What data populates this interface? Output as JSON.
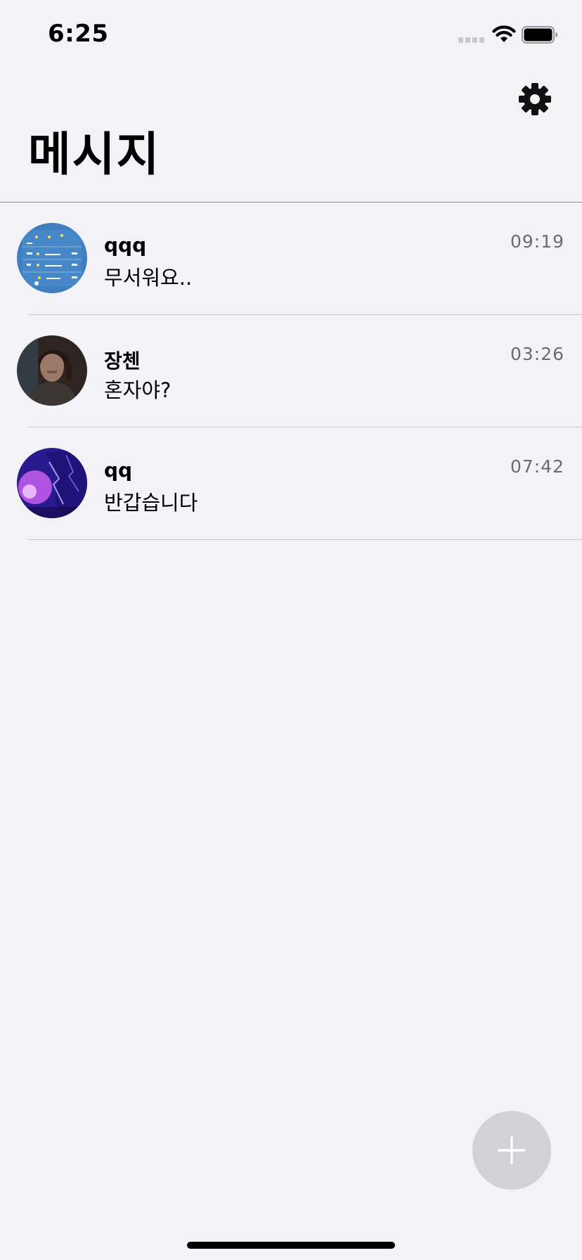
{
  "status_bar": {
    "time": "6:25"
  },
  "header": {
    "title": "메시지",
    "settings_icon": "gear-icon"
  },
  "conversations": [
    {
      "name": "qqq",
      "preview": "무서워요..",
      "time": "09:19"
    },
    {
      "name": "장첸",
      "preview": "혼자야?",
      "time": "03:26"
    },
    {
      "name": "qq",
      "preview": "반갑습니다",
      "time": "07:42"
    }
  ],
  "fab": {
    "icon": "plus-icon"
  },
  "colors": {
    "background": "#f2f2f7",
    "fab": "#d1d1d6",
    "divider": "#c6c6c8",
    "time_text": "#6c6c70"
  }
}
